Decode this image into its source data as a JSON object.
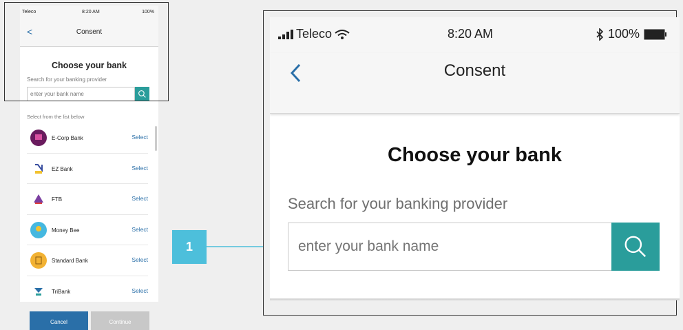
{
  "status": {
    "carrier": "Teleco",
    "time": "8:20 AM",
    "battery": "100%"
  },
  "nav": {
    "back_label": "<",
    "title": "Consent"
  },
  "page": {
    "heading": "Choose your bank",
    "search_label": "Search for your banking provider",
    "search_placeholder": "enter your bank name",
    "list_label": "Select from the list below"
  },
  "banks": [
    {
      "name": "E-Corp Bank",
      "action": "Select",
      "icon": "e-corp-logo",
      "color": "#6a1b5e"
    },
    {
      "name": "EZ Bank",
      "action": "Select",
      "icon": "ez-bank-logo",
      "color": "#f2c230"
    },
    {
      "name": "FTB",
      "action": "Select",
      "icon": "ftb-logo",
      "color": "#7b3fa0"
    },
    {
      "name": "Money Bee",
      "action": "Select",
      "icon": "money-bee-logo",
      "color": "#45b8e0"
    },
    {
      "name": "Standard Bank",
      "action": "Select",
      "icon": "standard-bank-logo",
      "color": "#f2b233"
    },
    {
      "name": "TriBank",
      "action": "Select",
      "icon": "tribank-logo",
      "color": "#2a9d9b"
    }
  ],
  "footer": {
    "cancel_label": "Cancel",
    "continue_label": "Continue"
  },
  "callout": {
    "number": "1"
  },
  "colors": {
    "accent": "#2a9d9b",
    "link": "#2a6fa8",
    "callout": "#4dbfdb",
    "disabled": "#c8c8c8"
  }
}
